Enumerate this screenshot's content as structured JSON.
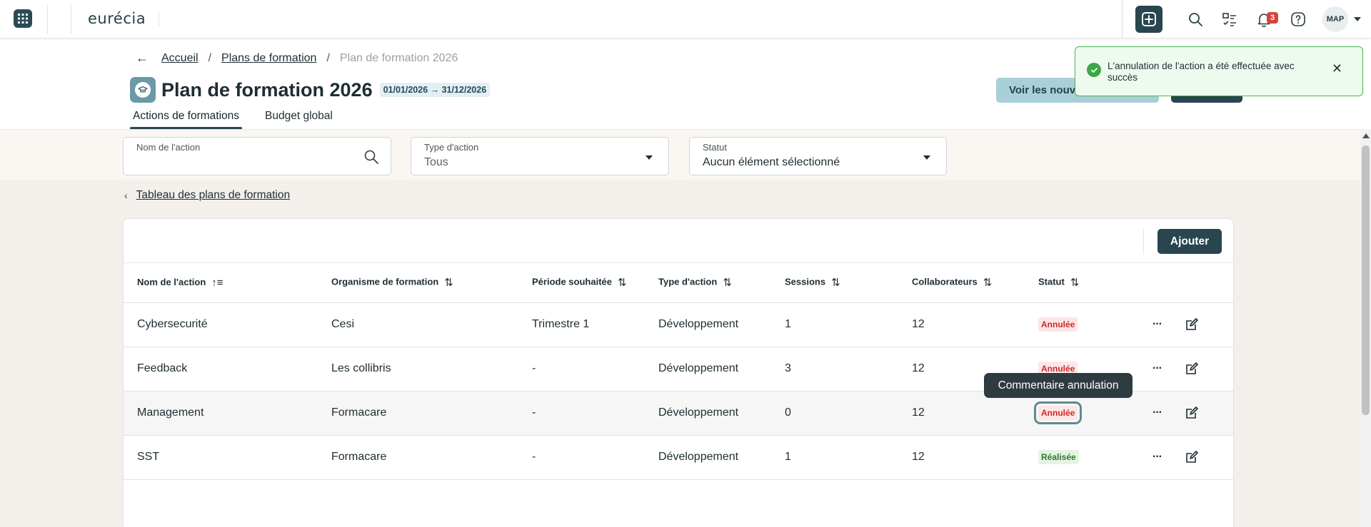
{
  "topbar": {
    "logo": "eurécia",
    "notification_count": "3",
    "avatar_initials": "MAP"
  },
  "breadcrumb": {
    "back_icon": "←",
    "items": [
      "Accueil",
      "Plans de formation"
    ],
    "separator": "/",
    "current": "Plan de formation 2026"
  },
  "header": {
    "title": "Plan de formation 2026",
    "date_range": "01/01/2026 → 31/12/2026",
    "voir_button": "Voir les nouv"
  },
  "tabs": [
    {
      "label": "Actions de formations",
      "active": true
    },
    {
      "label": "Budget global",
      "active": false
    }
  ],
  "filters": {
    "search": {
      "label": "Nom de l'action",
      "value": ""
    },
    "type": {
      "label": "Type d'action",
      "value": "Tous"
    },
    "statut": {
      "label": "Statut",
      "value": "Aucun élément sélectionné"
    }
  },
  "back_link": "Tableau des plans de formation",
  "table": {
    "add_button": "Ajouter",
    "columns": [
      "Nom de l'action",
      "Organisme de formation",
      "Période souhaitée",
      "Type d'action",
      "Sessions",
      "Collaborateurs",
      "Statut"
    ],
    "rows": [
      {
        "name": "Cybersecurité",
        "organisme": "Cesi",
        "periode": "Trimestre 1",
        "type": "Développement",
        "sessions": "1",
        "collaborateurs": "12",
        "statut": "Annulée",
        "statut_kind": "annulee"
      },
      {
        "name": "Feedback",
        "organisme": "Les collibris",
        "periode": "-",
        "type": "Développement",
        "sessions": "3",
        "collaborateurs": "12",
        "statut": "Annulée",
        "statut_kind": "annulee"
      },
      {
        "name": "Management",
        "organisme": "Formacare",
        "periode": "-",
        "type": "Développement",
        "sessions": "0",
        "collaborateurs": "12",
        "statut": "Annulée",
        "statut_kind": "annulee"
      },
      {
        "name": "SST",
        "organisme": "Formacare",
        "periode": "-",
        "type": "Développement",
        "sessions": "1",
        "collaborateurs": "12",
        "statut": "Réalisée",
        "statut_kind": "realisee"
      }
    ]
  },
  "tooltip": "Commentaire annulation",
  "toast": {
    "message": "L'annulation de l'action a été effectuée avec succès"
  },
  "colors": {
    "primary": "#29454f",
    "annulee": "#cc2a2a",
    "realisee": "#2c7a2c",
    "toast_border": "#4caf50"
  }
}
